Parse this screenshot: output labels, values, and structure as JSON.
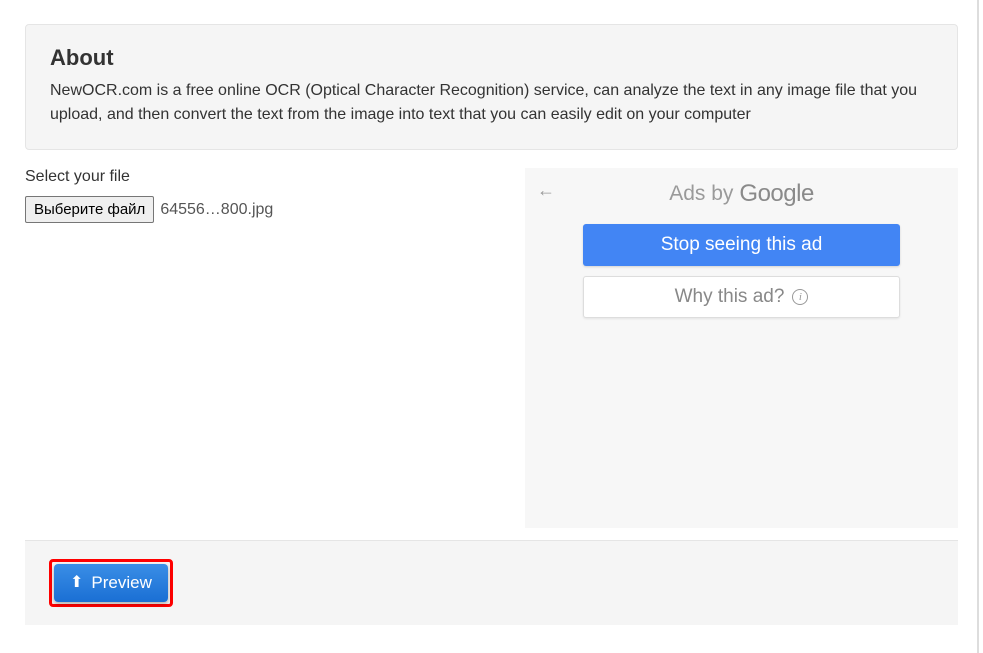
{
  "about": {
    "title": "About",
    "text": "NewOCR.com is a free online OCR (Optical Character Recognition) service, can analyze the text in any image file that you upload, and then convert the text from the image into text that you can easily edit on your computer"
  },
  "file_select": {
    "label": "Select your file",
    "button_label": "Выберите файл",
    "file_name": "64556…800.jpg"
  },
  "ad_panel": {
    "back_arrow": "←",
    "ads_by": "Ads by",
    "google": "Google",
    "stop_label": "Stop seeing this ad",
    "why_label": "Why this ad?",
    "info_glyph": "i"
  },
  "footer": {
    "preview_label": "Preview",
    "upload_glyph": "⬆"
  }
}
